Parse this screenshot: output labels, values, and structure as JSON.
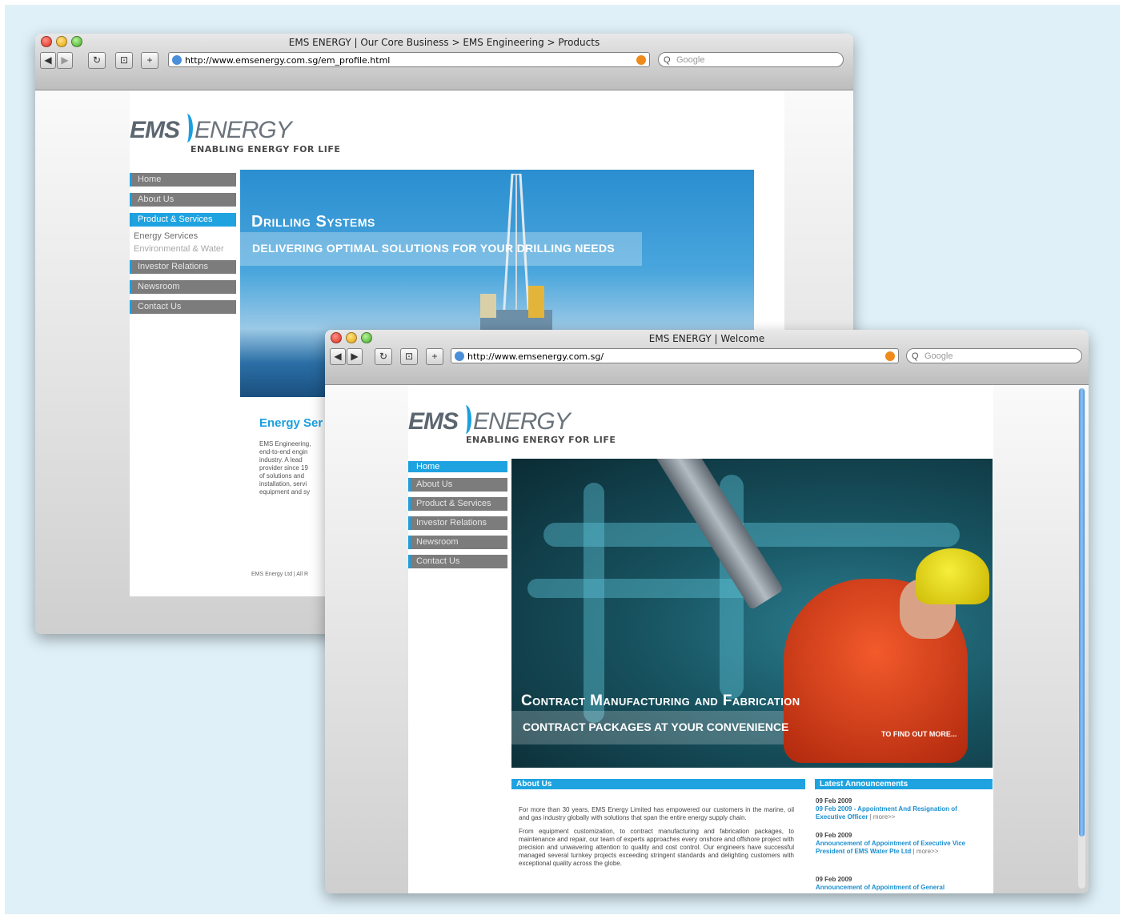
{
  "window_back": {
    "title": "EMS ENERGY | Our Core Business > EMS Engineering > Products",
    "url": "http://www.emsenergy.com.sg/em_profile.html",
    "search_placeholder": "Google",
    "logo": {
      "ems": "EMS",
      "energy": "ENERGY",
      "tagline": "ENABLING ENERGY FOR LIFE"
    },
    "nav": [
      {
        "label": "Home",
        "active": false
      },
      {
        "label": "About Us",
        "active": false
      },
      {
        "label": "Product & Services",
        "active": true
      }
    ],
    "subnav": [
      "Energy Services",
      "Environmental & Water"
    ],
    "nav_more": [
      "Investor Relations",
      "Newsroom",
      "Contact Us"
    ],
    "hero": {
      "title": "Drilling Systems",
      "subtitle": "DELIVERING OPTIMAL SOLUTIONS FOR YOUR DRILLING NEEDS"
    },
    "section_title": "Energy Ser",
    "section_body": [
      "EMS Engineering,",
      "end-to-end engin",
      "industry. A lead",
      "provider since 19",
      "of solutions and",
      "installation, servi",
      "equipment and sy"
    ],
    "footer": "EMS Energy Ltd | All R"
  },
  "window_front": {
    "title": "EMS ENERGY | Welcome",
    "url": "http://www.emsenergy.com.sg/",
    "search_placeholder": "Google",
    "logo": {
      "ems": "EMS",
      "energy": "ENERGY",
      "tagline": "ENABLING ENERGY FOR LIFE"
    },
    "nav": [
      {
        "label": "Home",
        "active": true
      },
      {
        "label": "About Us",
        "active": false
      },
      {
        "label": "Product & Services",
        "active": false
      },
      {
        "label": "Investor Relations",
        "active": false
      },
      {
        "label": "Newsroom",
        "active": false
      },
      {
        "label": "Contact Us",
        "active": false
      }
    ],
    "hero": {
      "title": "Contract Manufacturing and Fabrication",
      "subtitle": "CONTRACT PACKAGES AT YOUR CONVENIENCE",
      "more": "TO FIND OUT MORE..."
    },
    "about": {
      "heading": "About Us",
      "p1": "For more than 30 years, EMS Energy Limited has empowered our customers in the marine, oil and gas industry globally with solutions that span the entire energy supply chain.",
      "p2": "From equipment customization, to contract manufacturing and fabrication packages, to maintenance and repair, our team of experts approaches every onshore and offshore project with precision and unwavering attention to quality and cost control. Our engineers have successful managed several turnkey projects exceeding stringent standards and delighting customers with exceptional quality across the globe."
    },
    "announcements": {
      "heading": "Latest Announcements",
      "items": [
        {
          "date": "09 Feb 2009",
          "link": "09 Feb 2009 - Appointment And Resignation of Executive Officer",
          "more": "| more>>"
        },
        {
          "date": "09 Feb 2009",
          "link": "Announcement of Appointment of Executive Vice President of EMS Water Pte Ltd",
          "more": "| more>>"
        },
        {
          "date": "09 Feb 2009",
          "link": "Announcement of Appointment of General",
          "more": ""
        }
      ]
    }
  }
}
